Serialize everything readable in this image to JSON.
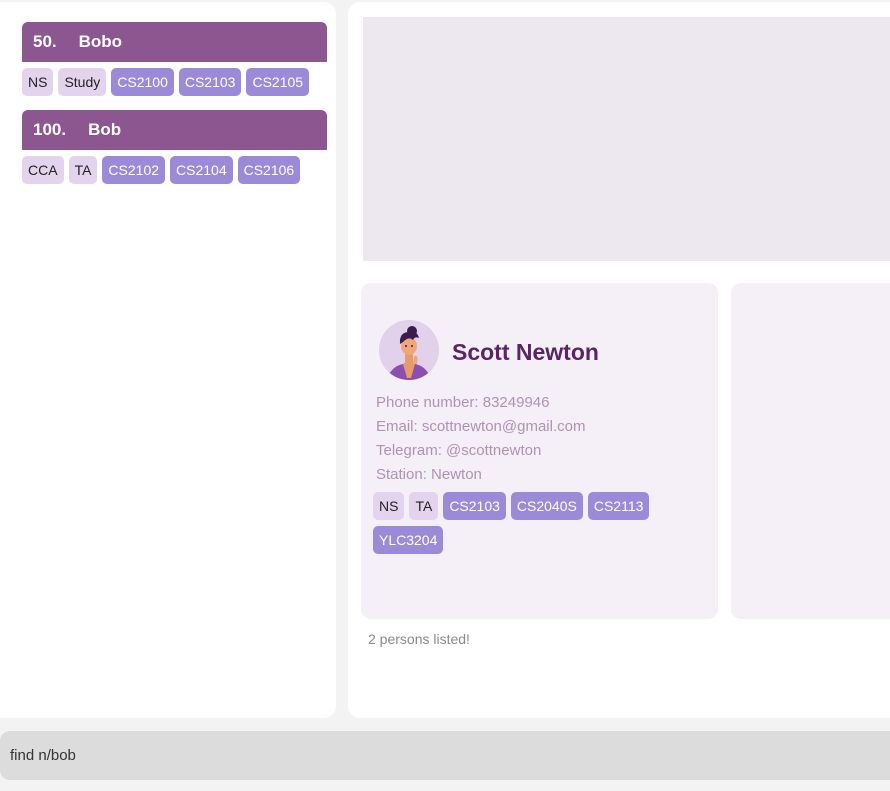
{
  "person_list": [
    {
      "index": "50.",
      "name": "Bobo",
      "tags": [
        "NS",
        "Study"
      ],
      "modules": [
        "CS2100",
        "CS2103",
        "CS2105"
      ]
    },
    {
      "index": "100.",
      "name": "Bob",
      "tags": [
        "CCA",
        "TA"
      ],
      "modules": [
        "CS2102",
        "CS2104",
        "CS2106"
      ]
    }
  ],
  "selected_person": {
    "name": "Scott Newton",
    "phone": "Phone number: 83249946",
    "email": "Email: scottnewton@gmail.com",
    "telegram": "Telegram: @scottnewton",
    "station": "Station: Newton",
    "tags": [
      "NS",
      "TA"
    ],
    "modules": [
      "CS2103",
      "CS2040S",
      "CS2113",
      "YLC3204"
    ]
  },
  "status_message": "2 persons listed!",
  "command": {
    "value": "find n/bob"
  },
  "colors": {
    "header_purple": "#8c5690",
    "tag_light": "#e4d3ec",
    "module_tag": "#9b8ad7",
    "name_purple": "#5a2466",
    "detail_text": "#b191b6"
  }
}
